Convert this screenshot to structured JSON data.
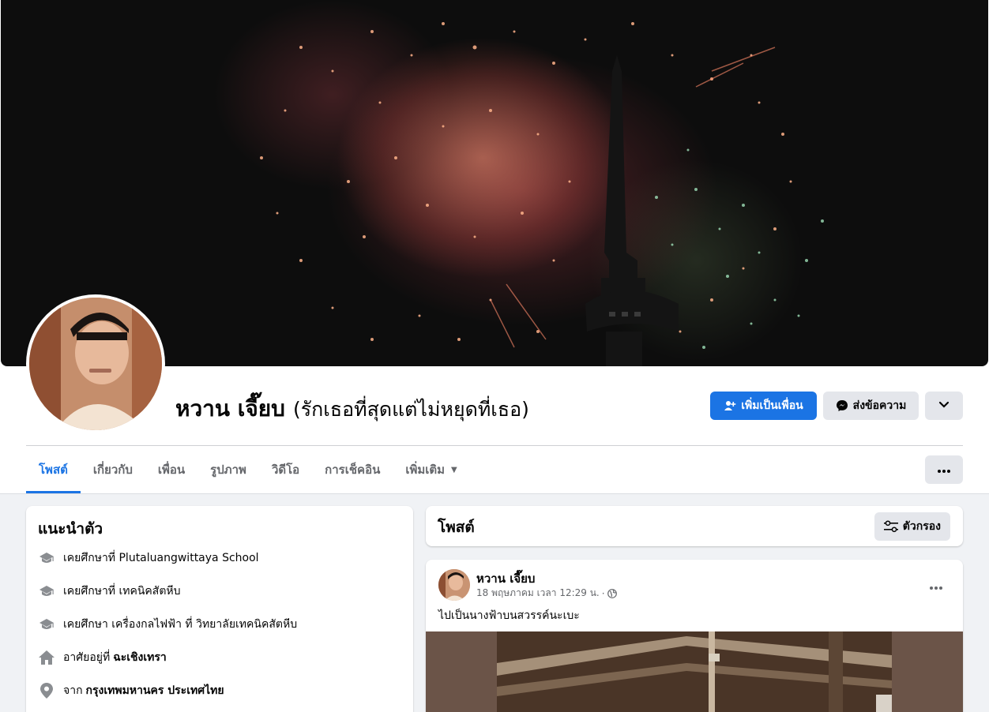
{
  "profile": {
    "name": "หวาน เจี๊ยบ",
    "alternate_name": "(รักเธอที่สุดแต่ไม่หยุดที่เธอ)"
  },
  "actions": {
    "add_friend": "เพิ่มเป็นเพื่อน",
    "message": "ส่งข้อความ"
  },
  "tabs": [
    {
      "label": "โพสต์",
      "active": true
    },
    {
      "label": "เกี่ยวกับ",
      "active": false
    },
    {
      "label": "เพื่อน",
      "active": false
    },
    {
      "label": "รูปภาพ",
      "active": false
    },
    {
      "label": "วิดีโอ",
      "active": false
    },
    {
      "label": "การเช็คอิน",
      "active": false
    },
    {
      "label": "เพิ่มเติม",
      "active": false
    }
  ],
  "intro": {
    "title": "แนะนำตัว",
    "items": [
      {
        "icon": "graduation-cap-icon",
        "text": "เคยศึกษาที่ Plutaluangwittaya School",
        "bold": ""
      },
      {
        "icon": "graduation-cap-icon",
        "text": "เคยศึกษาที่ เทคนิคสัตหีบ",
        "bold": ""
      },
      {
        "icon": "graduation-cap-icon",
        "text": "เคยศึกษา เครื่องกลไฟฟ้า ที่ วิทยาลัยเทคนิคสัตหีบ",
        "bold": ""
      },
      {
        "icon": "home-icon",
        "text": "อาศัยอยู่ที่",
        "bold": "ฉะเชิงเทรา"
      },
      {
        "icon": "location-pin-icon",
        "text": "จาก",
        "bold": "กรุงเทพมหานคร ประเทศไทย"
      }
    ]
  },
  "posts_header": {
    "title": "โพสต์",
    "filter_label": "ตัวกรอง"
  },
  "post": {
    "author": "หวาน เจี๊ยบ",
    "timestamp": "18 พฤษภาคม เวลา 12:29 น.",
    "separator": "·",
    "text": "ไปเป็นนางฟ้าบนสวรรค์นะเบะ"
  },
  "colors": {
    "accent": "#1b74e4",
    "background": "#f0f2f5",
    "secondary_text": "#65676b"
  }
}
